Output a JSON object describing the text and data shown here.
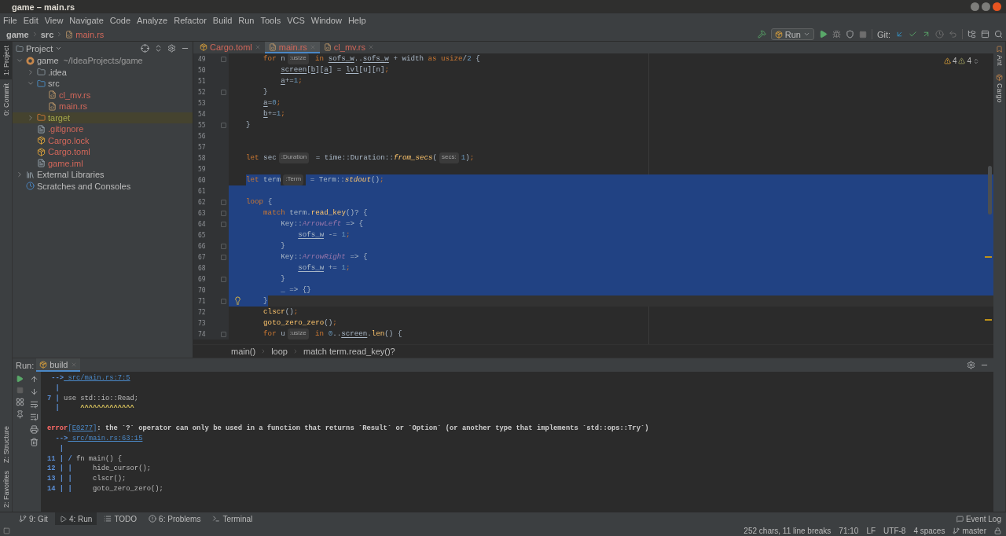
{
  "window": {
    "title": "game – main.rs"
  },
  "menu": [
    "File",
    "Edit",
    "View",
    "Navigate",
    "Code",
    "Analyze",
    "Refactor",
    "Build",
    "Run",
    "Tools",
    "VCS",
    "Window",
    "Help"
  ],
  "breadcrumb": [
    "game",
    "src",
    "main.rs"
  ],
  "toolbar": {
    "run_config": "Run",
    "git_label": "Git:"
  },
  "left_strip": {
    "top": [
      {
        "label": "1: Project",
        "selected": true
      },
      {
        "label": "0: Commit",
        "selected": false
      }
    ],
    "bottom": [
      {
        "label": "Z: Structure",
        "selected": false
      },
      {
        "label": "2: Favorites",
        "selected": false
      }
    ]
  },
  "right_strip": [
    "Ant",
    "Cargo"
  ],
  "project": {
    "title": "Project",
    "tree": [
      {
        "name": "game",
        "path": "~/IdeaProjects/game",
        "kind": "module",
        "expanded": true,
        "selected": false,
        "color": "#bbbbbb",
        "children": [
          {
            "name": ".idea",
            "kind": "folder",
            "expanded": false,
            "selected": false,
            "color": "#bbbbbb"
          },
          {
            "name": "src",
            "kind": "source_folder",
            "expanded": true,
            "selected": false,
            "color": "#bbbbbb",
            "children": [
              {
                "name": "cl_mv.rs",
                "kind": "rust",
                "selected": false,
                "color": "#d1675a"
              },
              {
                "name": "main.rs",
                "kind": "rust",
                "selected": false,
                "color": "#d1675a"
              }
            ]
          },
          {
            "name": "target",
            "kind": "excluded_folder",
            "expanded": false,
            "selected": true,
            "color": "#a6a84a"
          },
          {
            "name": ".gitignore",
            "kind": "gitignore",
            "selected": false,
            "color": "#d1675a"
          },
          {
            "name": "Cargo.lock",
            "kind": "cargo_lock",
            "selected": false,
            "color": "#d1675a"
          },
          {
            "name": "Cargo.toml",
            "kind": "cargo_toml",
            "selected": false,
            "color": "#d1675a"
          },
          {
            "name": "game.iml",
            "kind": "iml",
            "selected": false,
            "color": "#d1675a"
          }
        ]
      },
      {
        "name": "External Libraries",
        "kind": "library",
        "expanded": false,
        "selected": false,
        "color": "#bbbbbb"
      },
      {
        "name": "Scratches and Consoles",
        "kind": "scratch",
        "selected": false,
        "color": "#bbbbbb"
      }
    ]
  },
  "tabs": [
    {
      "label": "Cargo.toml",
      "kind": "toml",
      "selected": false
    },
    {
      "label": "main.rs",
      "kind": "rust",
      "selected": true
    },
    {
      "label": "cl_mv.rs",
      "kind": "rust",
      "selected": false
    }
  ],
  "inspections": {
    "warnings": "4",
    "weak_warnings": "4"
  },
  "editor": {
    "lines": [
      {
        "n": "49",
        "kind": "line",
        "fold": true,
        "bulb": false,
        "current": false,
        "tokens": [
          {
            "t": "        for",
            "kind": "kw"
          },
          {
            "t": " n",
            "kind": "plain"
          },
          {
            "t": ":usize",
            "kind": "hint"
          },
          {
            "t": " in ",
            "kind": "kw"
          },
          {
            "t": "sofs_w",
            "kind": "var"
          },
          {
            "t": "..",
            "kind": "plain"
          },
          {
            "t": "sofs_w",
            "kind": "var"
          },
          {
            "t": " + width ",
            "kind": "plain"
          },
          {
            "t": "as usize",
            "kind": "kw"
          },
          {
            "t": "/",
            "kind": "plain"
          },
          {
            "t": "2",
            "kind": "num"
          },
          {
            "t": " {",
            "kind": "plain"
          }
        ]
      },
      {
        "n": "50",
        "kind": "line",
        "fold": false,
        "bulb": false,
        "current": false,
        "tokens": [
          {
            "t": "            screen",
            "kind": "var"
          },
          {
            "t": "[",
            "kind": "plain"
          },
          {
            "t": "b",
            "kind": "var"
          },
          {
            "t": "][",
            "kind": "plain"
          },
          {
            "t": "a",
            "kind": "var"
          },
          {
            "t": "] = ",
            "kind": "plain"
          },
          {
            "t": "lvl",
            "kind": "var"
          },
          {
            "t": "[u][n]",
            "kind": "plain"
          },
          {
            "t": ";",
            "kind": "punct"
          }
        ]
      },
      {
        "n": "51",
        "kind": "line",
        "fold": false,
        "bulb": false,
        "current": false,
        "tokens": [
          {
            "t": "            a",
            "kind": "var"
          },
          {
            "t": "+=",
            "kind": "plain"
          },
          {
            "t": "1",
            "kind": "num"
          },
          {
            "t": ";",
            "kind": "punct"
          }
        ]
      },
      {
        "n": "52",
        "kind": "line",
        "fold": true,
        "bulb": false,
        "current": false,
        "tokens": [
          {
            "t": "        }",
            "kind": "plain"
          }
        ]
      },
      {
        "n": "53",
        "kind": "line",
        "fold": false,
        "bulb": false,
        "current": false,
        "tokens": [
          {
            "t": "        a",
            "kind": "var"
          },
          {
            "t": "=",
            "kind": "plain"
          },
          {
            "t": "0",
            "kind": "num"
          },
          {
            "t": ";",
            "kind": "punct"
          }
        ]
      },
      {
        "n": "54",
        "kind": "line",
        "fold": false,
        "bulb": false,
        "current": false,
        "tokens": [
          {
            "t": "        b",
            "kind": "var"
          },
          {
            "t": "+=",
            "kind": "plain"
          },
          {
            "t": "1",
            "kind": "num"
          },
          {
            "t": ";",
            "kind": "punct"
          }
        ]
      },
      {
        "n": "55",
        "kind": "line",
        "fold": true,
        "bulb": false,
        "current": false,
        "tokens": [
          {
            "t": "    }",
            "kind": "plain"
          }
        ]
      },
      {
        "n": "56",
        "kind": "line",
        "fold": false,
        "bulb": false,
        "current": false
      },
      {
        "n": "57",
        "kind": "line",
        "fold": false,
        "bulb": false,
        "current": false
      },
      {
        "n": "58",
        "kind": "line",
        "fold": false,
        "bulb": false,
        "current": false,
        "tokens": [
          {
            "t": "    let",
            "kind": "kw"
          },
          {
            "t": " sec",
            "kind": "plain"
          },
          {
            "t": ":Duration",
            "kind": "hint"
          },
          {
            "t": " = time::Duration::",
            "kind": "plain"
          },
          {
            "t": "from_secs",
            "kind": "ital"
          },
          {
            "t": "(",
            "kind": "plain"
          },
          {
            "t": "secs:",
            "kind": "hint"
          },
          {
            "t": "1",
            "kind": "num"
          },
          {
            "t": ")",
            "kind": "plain"
          },
          {
            "t": ";",
            "kind": "punct"
          }
        ]
      },
      {
        "n": "59",
        "kind": "line",
        "fold": false,
        "bulb": false,
        "current": false
      },
      {
        "n": "60",
        "kind": "selection_start",
        "fold": false,
        "bulb": false,
        "current": false,
        "tokens": [
          {
            "t": "    let",
            "kind": "kw"
          },
          {
            "t": " term",
            "kind": "plain"
          },
          {
            "t": ":Term",
            "kind": "hint"
          },
          {
            "t": " = Term::",
            "kind": "plain"
          },
          {
            "t": "stdout",
            "kind": "ital"
          },
          {
            "t": "()",
            "kind": "plain"
          },
          {
            "t": ";",
            "kind": "punct"
          }
        ]
      },
      {
        "n": "61",
        "kind": "selection_middle",
        "fold": false,
        "bulb": false,
        "current": false
      },
      {
        "n": "62",
        "kind": "selection_middle",
        "fold": true,
        "bulb": false,
        "current": false,
        "tokens": [
          {
            "t": "    loop",
            "kind": "kw"
          },
          {
            "t": " {",
            "kind": "plain"
          }
        ]
      },
      {
        "n": "63",
        "kind": "selection_middle",
        "fold": true,
        "bulb": false,
        "current": false,
        "tokens": [
          {
            "t": "        match",
            "kind": "kw"
          },
          {
            "t": " term.",
            "kind": "plain"
          },
          {
            "t": "read_key",
            "kind": "fn"
          },
          {
            "t": "()? {",
            "kind": "plain"
          }
        ]
      },
      {
        "n": "64",
        "kind": "selection_middle",
        "fold": true,
        "bulb": false,
        "current": false,
        "tokens": [
          {
            "t": "            Key::",
            "kind": "plain"
          },
          {
            "t": "ArrowLeft",
            "kind": "enum"
          },
          {
            "t": " => {",
            "kind": "plain"
          }
        ]
      },
      {
        "n": "65",
        "kind": "selection_middle",
        "fold": false,
        "bulb": false,
        "current": false,
        "tokens": [
          {
            "t": "                sofs_w",
            "kind": "var"
          },
          {
            "t": " -= ",
            "kind": "plain"
          },
          {
            "t": "1",
            "kind": "num"
          },
          {
            "t": ";",
            "kind": "punct"
          }
        ]
      },
      {
        "n": "66",
        "kind": "selection_middle",
        "fold": true,
        "bulb": false,
        "current": false,
        "tokens": [
          {
            "t": "            }",
            "kind": "plain"
          }
        ]
      },
      {
        "n": "67",
        "kind": "selection_middle",
        "fold": true,
        "bulb": false,
        "current": false,
        "tokens": [
          {
            "t": "            Key::",
            "kind": "plain"
          },
          {
            "t": "ArrowRight",
            "kind": "enum"
          },
          {
            "t": " => {",
            "kind": "plain"
          }
        ]
      },
      {
        "n": "68",
        "kind": "selection_middle",
        "fold": false,
        "bulb": false,
        "current": false,
        "tokens": [
          {
            "t": "                sofs_w",
            "kind": "var"
          },
          {
            "t": " += ",
            "kind": "plain"
          },
          {
            "t": "1",
            "kind": "num"
          },
          {
            "t": ";",
            "kind": "punct"
          }
        ]
      },
      {
        "n": "69",
        "kind": "selection_middle",
        "fold": true,
        "bulb": false,
        "current": false,
        "tokens": [
          {
            "t": "            }",
            "kind": "plain"
          }
        ]
      },
      {
        "n": "70",
        "kind": "selection_middle",
        "fold": false,
        "bulb": false,
        "current": false,
        "tokens": [
          {
            "t": "            _ => {}",
            "kind": "plain"
          }
        ]
      },
      {
        "n": "71",
        "kind": "selection_end",
        "fold": true,
        "bulb": true,
        "current": true,
        "tokens": [
          {
            "t": "        }",
            "kind": "plain"
          }
        ]
      },
      {
        "n": "72",
        "kind": "line",
        "fold": false,
        "bulb": false,
        "current": false,
        "tokens": [
          {
            "t": "        clscr",
            "kind": "fn"
          },
          {
            "t": "()",
            "kind": "plain"
          },
          {
            "t": ";",
            "kind": "punct"
          }
        ]
      },
      {
        "n": "73",
        "kind": "line",
        "fold": false,
        "bulb": false,
        "current": false,
        "tokens": [
          {
            "t": "        goto_zero_zero",
            "kind": "fn"
          },
          {
            "t": "()",
            "kind": "plain"
          },
          {
            "t": ";",
            "kind": "punct"
          }
        ]
      },
      {
        "n": "74",
        "kind": "line",
        "fold": true,
        "bulb": false,
        "current": false,
        "tokens": [
          {
            "t": "        for",
            "kind": "kw"
          },
          {
            "t": " u",
            "kind": "plain"
          },
          {
            "t": ":usize",
            "kind": "hint"
          },
          {
            "t": " in ",
            "kind": "kw"
          },
          {
            "t": "0",
            "kind": "num"
          },
          {
            "t": "..",
            "kind": "plain"
          },
          {
            "t": "screen",
            "kind": "var"
          },
          {
            "t": ".",
            "kind": "plain"
          },
          {
            "t": "len",
            "kind": "fn"
          },
          {
            "t": "() {",
            "kind": "plain"
          }
        ]
      }
    ]
  },
  "editor_breadcrumb": [
    "main()",
    "loop",
    "match term.read_key()?"
  ],
  "run": {
    "label": "Run:",
    "tab": "build",
    "console": [
      {
        "gap_before": false,
        "segs": [
          {
            "t": " -->",
            "kind": "gutter"
          },
          {
            "t": " src/main.rs:7:5",
            "kind": "link"
          }
        ]
      },
      {
        "gap_before": false,
        "segs": [
          {
            "t": "  |",
            "kind": "gutter"
          }
        ]
      },
      {
        "gap_before": false,
        "segs": [
          {
            "t": "7 |",
            "kind": "gutter"
          },
          {
            "t": " use std::io::Read;",
            "kind": "plain"
          }
        ]
      },
      {
        "gap_before": false,
        "segs": [
          {
            "t": "  |",
            "kind": "gutter"
          },
          {
            "t": "     ^^^^^^^^^^^^^",
            "kind": "caret"
          }
        ]
      },
      {
        "gap_before": true,
        "segs": [
          {
            "t": "error",
            "kind": "error"
          },
          {
            "t": "[E0277]",
            "kind": "link"
          },
          {
            "t": ": the `?` operator can only be used in a function that returns `Result` or `Option` (or another type that implements `std::ops::Try`)",
            "kind": "bold"
          }
        ]
      },
      {
        "gap_before": false,
        "segs": [
          {
            "t": "  -->",
            "kind": "gutter"
          },
          {
            "t": " src/main.rs:63:15",
            "kind": "link"
          }
        ]
      },
      {
        "gap_before": false,
        "segs": [
          {
            "t": "   |",
            "kind": "gutter"
          }
        ]
      },
      {
        "gap_before": false,
        "segs": [
          {
            "t": "11 | /",
            "kind": "gutter"
          },
          {
            "t": " fn main() {",
            "kind": "plain"
          }
        ]
      },
      {
        "gap_before": false,
        "segs": [
          {
            "t": "12 | |",
            "kind": "gutter"
          },
          {
            "t": "     hide_cursor();",
            "kind": "plain"
          }
        ]
      },
      {
        "gap_before": false,
        "segs": [
          {
            "t": "13 | |",
            "kind": "gutter"
          },
          {
            "t": "     clscr();",
            "kind": "plain"
          }
        ]
      },
      {
        "gap_before": false,
        "segs": [
          {
            "t": "14 | |",
            "kind": "gutter"
          },
          {
            "t": "     goto_zero_zero();",
            "kind": "plain"
          }
        ]
      }
    ]
  },
  "tool_tabs": [
    {
      "label": "9: Git",
      "kind": "git",
      "selected": false
    },
    {
      "label": "4: Run",
      "kind": "run",
      "selected": true
    },
    {
      "label": "TODO",
      "kind": "todo",
      "selected": false
    },
    {
      "label": "6: Problems",
      "kind": "problems",
      "selected": false
    },
    {
      "label": "Terminal",
      "kind": "terminal",
      "selected": false
    }
  ],
  "event_log": "Event Log",
  "status": [
    "252 chars, 11 line breaks",
    "71:10",
    "LF",
    "UTF-8",
    "4 spaces"
  ],
  "branch": "master"
}
